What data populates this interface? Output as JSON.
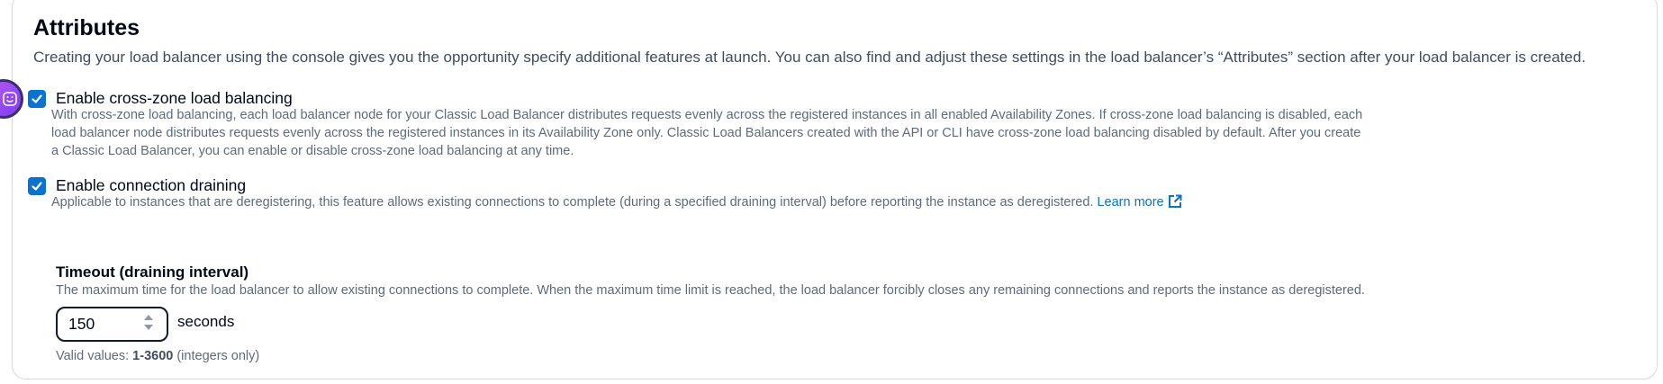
{
  "section": {
    "title": "Attributes",
    "description": "Creating your load balancer using the console gives you the opportunity specify additional features at launch. You can also find and adjust these settings in the load balancer’s “Attributes” section after your load balancer is created."
  },
  "cross_zone": {
    "checked": true,
    "label": "Enable cross-zone load balancing",
    "help": "With cross-zone load balancing, each load balancer node for your Classic Load Balancer distributes requests evenly across the registered instances in all enabled Availability Zones. If cross-zone load balancing is disabled, each load balancer node distributes requests evenly across the registered instances in its Availability Zone only. Classic Load Balancers created with the API or CLI have cross-zone load balancing disabled by default. After you create a Classic Load Balancer, you can enable or disable cross-zone load balancing at any time."
  },
  "connection_draining": {
    "checked": true,
    "label": "Enable connection draining",
    "help": "Applicable to instances that are deregistering, this feature allows existing connections to complete (during a specified draining interval) before reporting the instance as deregistered.",
    "learn_more": "Learn more"
  },
  "timeout": {
    "label": "Timeout (draining interval)",
    "description": "The maximum time for the load balancer to allow existing connections to complete. When the maximum time limit is reached, the load balancer forcibly closes any remaining connections and reports the instance as deregistered.",
    "value": "150",
    "unit": "seconds",
    "constraint_prefix": "Valid values: ",
    "constraint_range": "1-3600",
    "constraint_suffix": " (integers only)"
  },
  "icons": {
    "checkbox": "checkmark-icon",
    "external": "external-link-icon",
    "assistant": "assistant-avatar-icon"
  },
  "colors": {
    "accent": "#0972d3",
    "avatar": "#9b4df4"
  }
}
